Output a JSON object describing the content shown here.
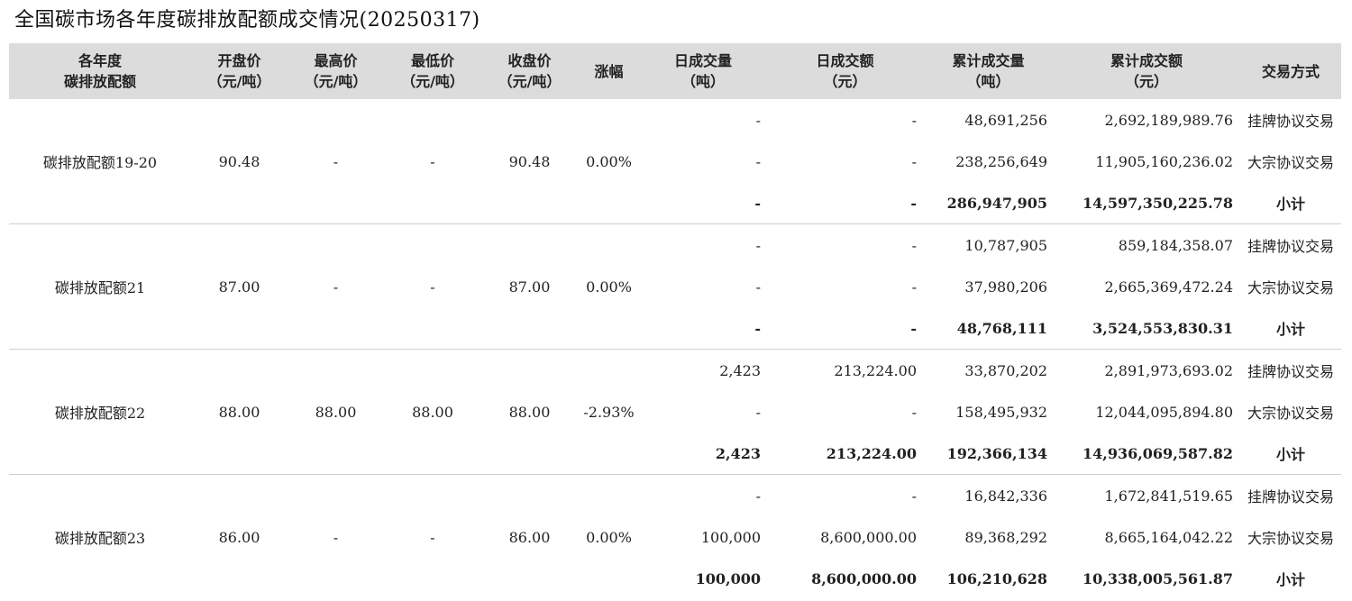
{
  "title": "全国碳市场各年度碳排放配额成交情况(20250317)",
  "headers": [
    [
      "各年度",
      "碳排放配额"
    ],
    [
      "开盘价",
      "（元/吨）"
    ],
    [
      "最高价",
      "（元/吨）"
    ],
    [
      "最低价",
      "（元/吨）"
    ],
    [
      "收盘价",
      "（元/吨）"
    ],
    [
      "涨幅"
    ],
    [
      "日成交量",
      "（吨）"
    ],
    [
      "日成交额",
      "（元）"
    ],
    [
      "累计成交量",
      "（吨）"
    ],
    [
      "累计成交额",
      "（元）"
    ],
    [
      "交易方式"
    ]
  ],
  "groups": [
    {
      "name": "碳排放配额19-20",
      "open": "90.48",
      "high": "-",
      "low": "-",
      "close": "90.48",
      "change": "0.00%",
      "rows": [
        {
          "vol": "-",
          "amt": "-",
          "cum_vol": "48,691,256",
          "cum_amt": "2,692,189,989.76",
          "mode": "挂牌协议交易"
        },
        {
          "vol": "-",
          "amt": "-",
          "cum_vol": "238,256,649",
          "cum_amt": "11,905,160,236.02",
          "mode": "大宗协议交易"
        },
        {
          "vol": "-",
          "amt": "-",
          "cum_vol": "286,947,905",
          "cum_amt": "14,597,350,225.78",
          "mode": "小计"
        }
      ]
    },
    {
      "name": "碳排放配额21",
      "open": "87.00",
      "high": "-",
      "low": "-",
      "close": "87.00",
      "change": "0.00%",
      "rows": [
        {
          "vol": "-",
          "amt": "-",
          "cum_vol": "10,787,905",
          "cum_amt": "859,184,358.07",
          "mode": "挂牌协议交易"
        },
        {
          "vol": "-",
          "amt": "-",
          "cum_vol": "37,980,206",
          "cum_amt": "2,665,369,472.24",
          "mode": "大宗协议交易"
        },
        {
          "vol": "-",
          "amt": "-",
          "cum_vol": "48,768,111",
          "cum_amt": "3,524,553,830.31",
          "mode": "小计"
        }
      ]
    },
    {
      "name": "碳排放配额22",
      "open": "88.00",
      "high": "88.00",
      "low": "88.00",
      "close": "88.00",
      "change": "-2.93%",
      "rows": [
        {
          "vol": "2,423",
          "amt": "213,224.00",
          "cum_vol": "33,870,202",
          "cum_amt": "2,891,973,693.02",
          "mode": "挂牌协议交易"
        },
        {
          "vol": "-",
          "amt": "-",
          "cum_vol": "158,495,932",
          "cum_amt": "12,044,095,894.80",
          "mode": "大宗协议交易"
        },
        {
          "vol": "2,423",
          "amt": "213,224.00",
          "cum_vol": "192,366,134",
          "cum_amt": "14,936,069,587.82",
          "mode": "小计"
        }
      ]
    },
    {
      "name": "碳排放配额23",
      "open": "86.00",
      "high": "-",
      "low": "-",
      "close": "86.00",
      "change": "0.00%",
      "rows": [
        {
          "vol": "-",
          "amt": "-",
          "cum_vol": "16,842,336",
          "cum_amt": "1,672,841,519.65",
          "mode": "挂牌协议交易"
        },
        {
          "vol": "100,000",
          "amt": "8,600,000.00",
          "cum_vol": "89,368,292",
          "cum_amt": "8,665,164,042.22",
          "mode": "大宗协议交易"
        },
        {
          "vol": "100,000",
          "amt": "8,600,000.00",
          "cum_vol": "106,210,628",
          "cum_amt": "10,338,005,561.87",
          "mode": "小计"
        }
      ]
    }
  ]
}
